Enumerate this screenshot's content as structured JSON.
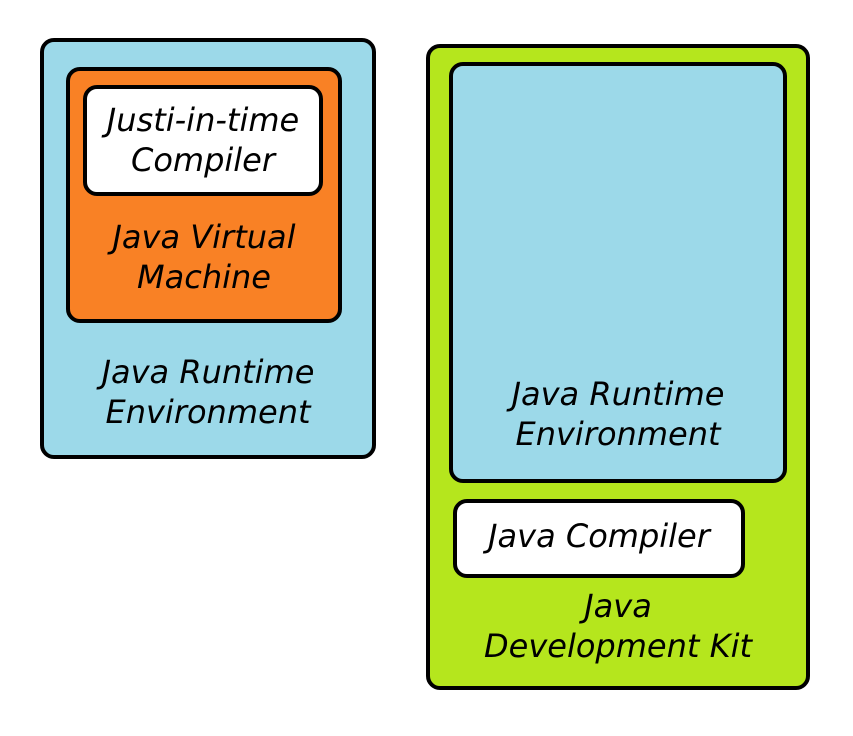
{
  "left_diagram": {
    "jre_label": "Java Runtime\nEnvironment",
    "jvm_label": "Java Virtual\nMachine",
    "jit_label": "Justi-in-time\nCompiler"
  },
  "right_diagram": {
    "jre_label": "Java Runtime\nEnvironment",
    "compiler_label": "Java Compiler",
    "jdk_label": "Java\nDevelopment Kit"
  },
  "colors": {
    "jre": "#9cd9e9",
    "jvm": "#f98125",
    "jdk": "#b5e61d",
    "inner_white": "#ffffff"
  }
}
